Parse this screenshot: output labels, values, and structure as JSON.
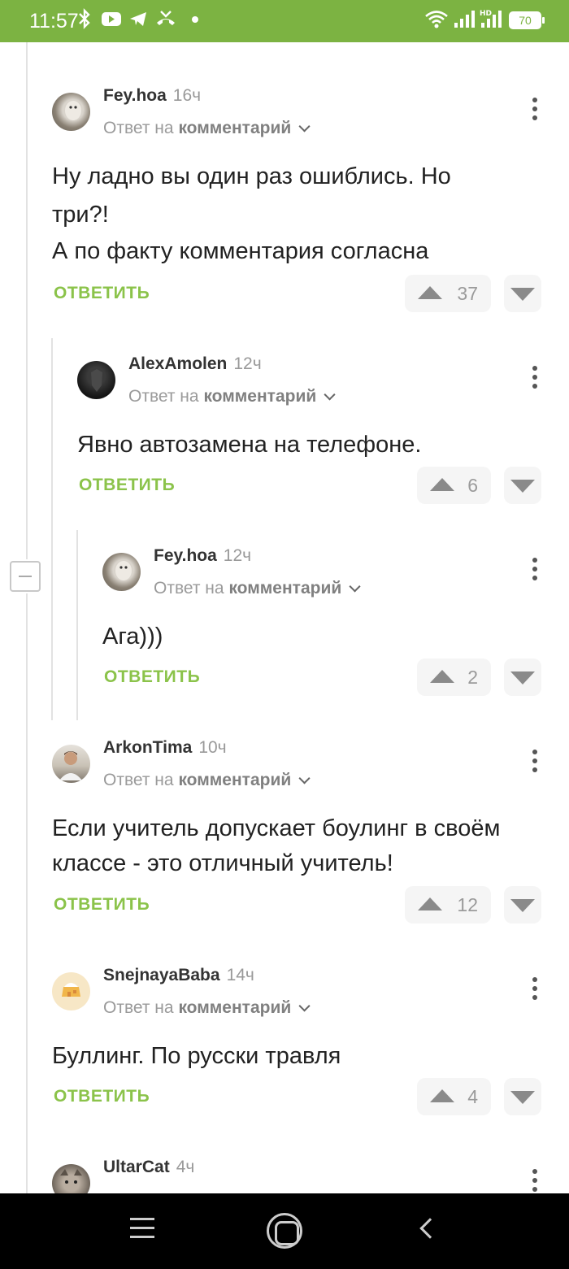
{
  "status_bar": {
    "time": "11:57",
    "battery": "70",
    "left_icons": [
      "bluetooth-icon",
      "youtube-icon",
      "telegram-icon",
      "missed-call-icon",
      "dot-icon"
    ],
    "right_icons": [
      "wifi-icon",
      "signal-icon",
      "hd-signal-icon"
    ]
  },
  "colors": {
    "accent": "#7cb342",
    "reply": "#8bc34a"
  },
  "comments": [
    {
      "author": "Fey.hoa",
      "ago": "16ч",
      "reply_prefix": "Ответ на",
      "reply_target": "комментарий",
      "lines": [
        "Ну ладно вы один раз ошиблись. Но",
        "три?!",
        "А по факту комментария согласна"
      ],
      "reply_label": "ОТВЕТИТЬ",
      "votes": "37"
    },
    {
      "author": "AlexAmolen",
      "ago": "12ч",
      "reply_prefix": "Ответ на",
      "reply_target": "комментарий",
      "lines": [
        "Явно автозамена на телефоне."
      ],
      "reply_label": "ОТВЕТИТЬ",
      "votes": "6"
    },
    {
      "author": "Fey.hoa",
      "ago": "12ч",
      "reply_prefix": "Ответ на",
      "reply_target": "комментарий",
      "lines": [
        "Ага)))"
      ],
      "reply_label": "ОТВЕТИТЬ",
      "votes": "2"
    },
    {
      "author": "ArkonTima",
      "ago": "10ч",
      "reply_prefix": "Ответ на",
      "reply_target": "комментарий",
      "lines": [
        "Если учитель допускает боулинг в своём",
        "классе - это отличный учитель!"
      ],
      "reply_label": "ОТВЕТИТЬ",
      "votes": "12"
    },
    {
      "author": "SnejnayaBaba",
      "ago": "14ч",
      "reply_prefix": "Ответ на",
      "reply_target": "комментарий",
      "lines": [
        "Буллинг. По русски травля"
      ],
      "reply_label": "ОТВЕТИТЬ",
      "votes": "4"
    },
    {
      "author": "UltarCat",
      "ago": "4ч"
    }
  ]
}
